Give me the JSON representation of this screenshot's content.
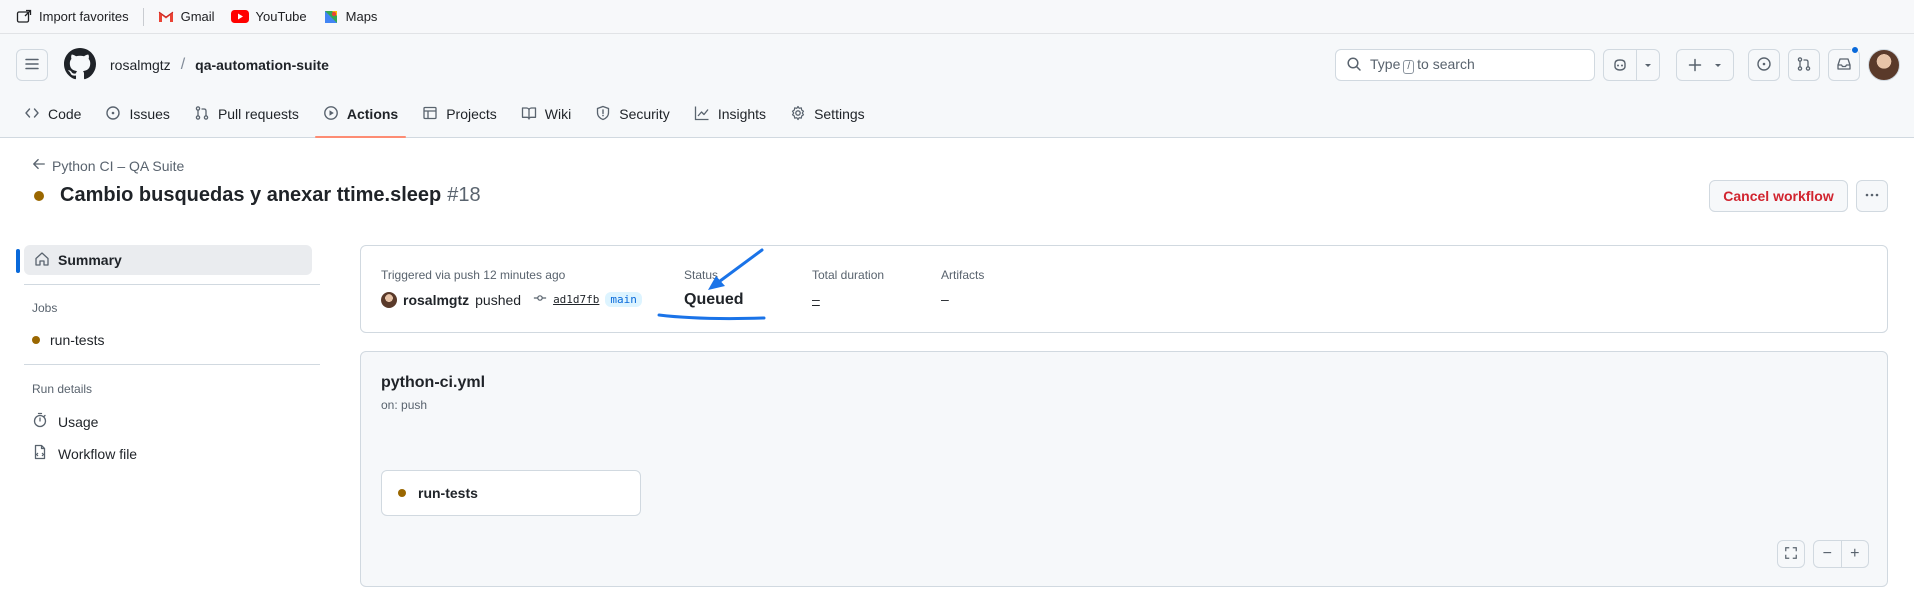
{
  "bookmarks": {
    "items": [
      {
        "label": "Import favorites",
        "icon": "import-favorites-icon"
      },
      {
        "label": "Gmail",
        "icon": "gmail-icon"
      },
      {
        "label": "YouTube",
        "icon": "youtube-icon"
      },
      {
        "label": "Maps",
        "icon": "maps-icon"
      }
    ]
  },
  "header": {
    "owner": "rosalmgtz",
    "separator": "/",
    "repo": "qa-automation-suite",
    "search": {
      "prefix": "Type",
      "key": "/",
      "suffix": "to search"
    }
  },
  "tabs": [
    {
      "label": "Code",
      "icon": "code-icon"
    },
    {
      "label": "Issues",
      "icon": "issue-icon"
    },
    {
      "label": "Pull requests",
      "icon": "pull-request-icon"
    },
    {
      "label": "Actions",
      "icon": "play-icon",
      "active": true
    },
    {
      "label": "Projects",
      "icon": "table-icon"
    },
    {
      "label": "Wiki",
      "icon": "book-icon"
    },
    {
      "label": "Security",
      "icon": "shield-icon"
    },
    {
      "label": "Insights",
      "icon": "graph-icon"
    },
    {
      "label": "Settings",
      "icon": "gear-icon"
    }
  ],
  "run": {
    "back_label": "Python CI – QA Suite",
    "title": "Cambio busquedas y anexar ttime.sleep",
    "number": "#18",
    "status_color": "#9a6700",
    "cancel_label": "Cancel workflow"
  },
  "sidebar": {
    "summary_label": "Summary",
    "jobs_heading": "Jobs",
    "jobs": [
      {
        "label": "run-tests"
      }
    ],
    "run_details_heading": "Run details",
    "details": [
      {
        "label": "Usage",
        "icon": "stopwatch-icon"
      },
      {
        "label": "Workflow file",
        "icon": "file-icon"
      }
    ]
  },
  "summary": {
    "trigger_label": "Triggered via push 12 minutes ago",
    "actor": "rosalmgtz",
    "action": "pushed",
    "commit": "ad1d7fb",
    "branch": "main",
    "status_label": "Status",
    "status_value": "Queued",
    "duration_label": "Total duration",
    "duration_value": "–",
    "artifacts_label": "Artifacts",
    "artifacts_value": "–"
  },
  "workflow": {
    "file": "python-ci.yml",
    "trigger": "on: push",
    "job": "run-tests",
    "zoom_out": "−",
    "zoom_in": "+"
  },
  "colors": {
    "accent": "#0969da",
    "danger": "#d1242f",
    "queued": "#9a6700",
    "active_tab": "#fd8c73",
    "annotation": "#1a73e8"
  }
}
